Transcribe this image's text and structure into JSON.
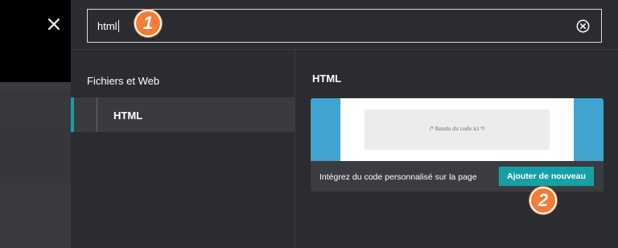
{
  "search": {
    "value": "html"
  },
  "markers": [
    "1",
    "2"
  ],
  "sidebar": {
    "section_title": "Fichiers et Web",
    "items": [
      {
        "label": "HTML"
      }
    ]
  },
  "content": {
    "title": "HTML",
    "card": {
      "preview_text": "/* Rendu du code ici */",
      "description": "Intégrez du code personnalisé sur la page",
      "add_button_label": "Ajouter de nouveau"
    }
  },
  "colors": {
    "accent": "#16a0a4",
    "marker": "#f47b38",
    "preview_blue": "#41a3cf",
    "panel_bg": "#2b2c30"
  }
}
